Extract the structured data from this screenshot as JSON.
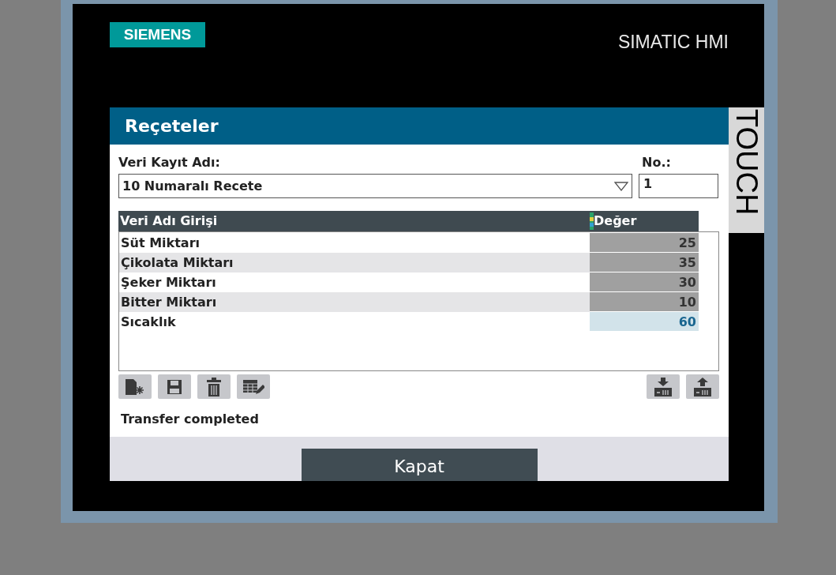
{
  "header": {
    "logo": "SIEMENS",
    "product": "SIMATIC HMI",
    "side_label": "TOUCH"
  },
  "dialog": {
    "title": "Reçeteler",
    "record_label": "Veri Kayıt Adı:",
    "record_value": "10 Numaralı Recete",
    "number_label": "No.:",
    "number_value": "1",
    "table": {
      "columns": [
        "Veri Adı Girişi",
        "Değer"
      ],
      "rows": [
        {
          "name": "Süt Miktarı",
          "value": "25",
          "selected": false
        },
        {
          "name": "Çikolata Miktarı",
          "value": "35",
          "selected": false
        },
        {
          "name": "Şeker Miktarı",
          "value": "30",
          "selected": false
        },
        {
          "name": "Bitter Miktarı",
          "value": "10",
          "selected": false
        },
        {
          "name": "Sıcaklık",
          "value": "60",
          "selected": true
        }
      ]
    },
    "status": "Transfer completed",
    "close_button": "Kapat"
  }
}
